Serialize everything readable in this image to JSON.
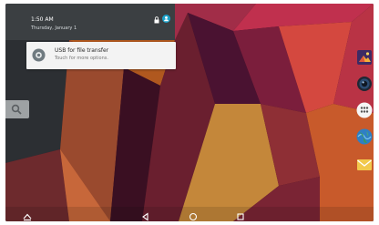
{
  "status": {
    "time": "1:50 AM",
    "date": "Thursday, January 1"
  },
  "notification": {
    "title": "USB for file transfer",
    "subtitle": "Touch for more options."
  },
  "colors": {
    "shade": "#3b3f42",
    "card": "#f3f3f3",
    "accent": "#1ba1c9"
  },
  "icons": {
    "lock": "lock-icon",
    "user": "user-icon",
    "usb": "usb-icon",
    "search": "search-icon",
    "gallery": "gallery-icon",
    "camera": "camera-icon",
    "all_apps": "all-apps-icon",
    "browser": "browser-icon",
    "email": "email-icon",
    "nav_up": "nav-up-icon",
    "back": "back-icon",
    "home": "home-icon",
    "recents": "recents-icon"
  }
}
